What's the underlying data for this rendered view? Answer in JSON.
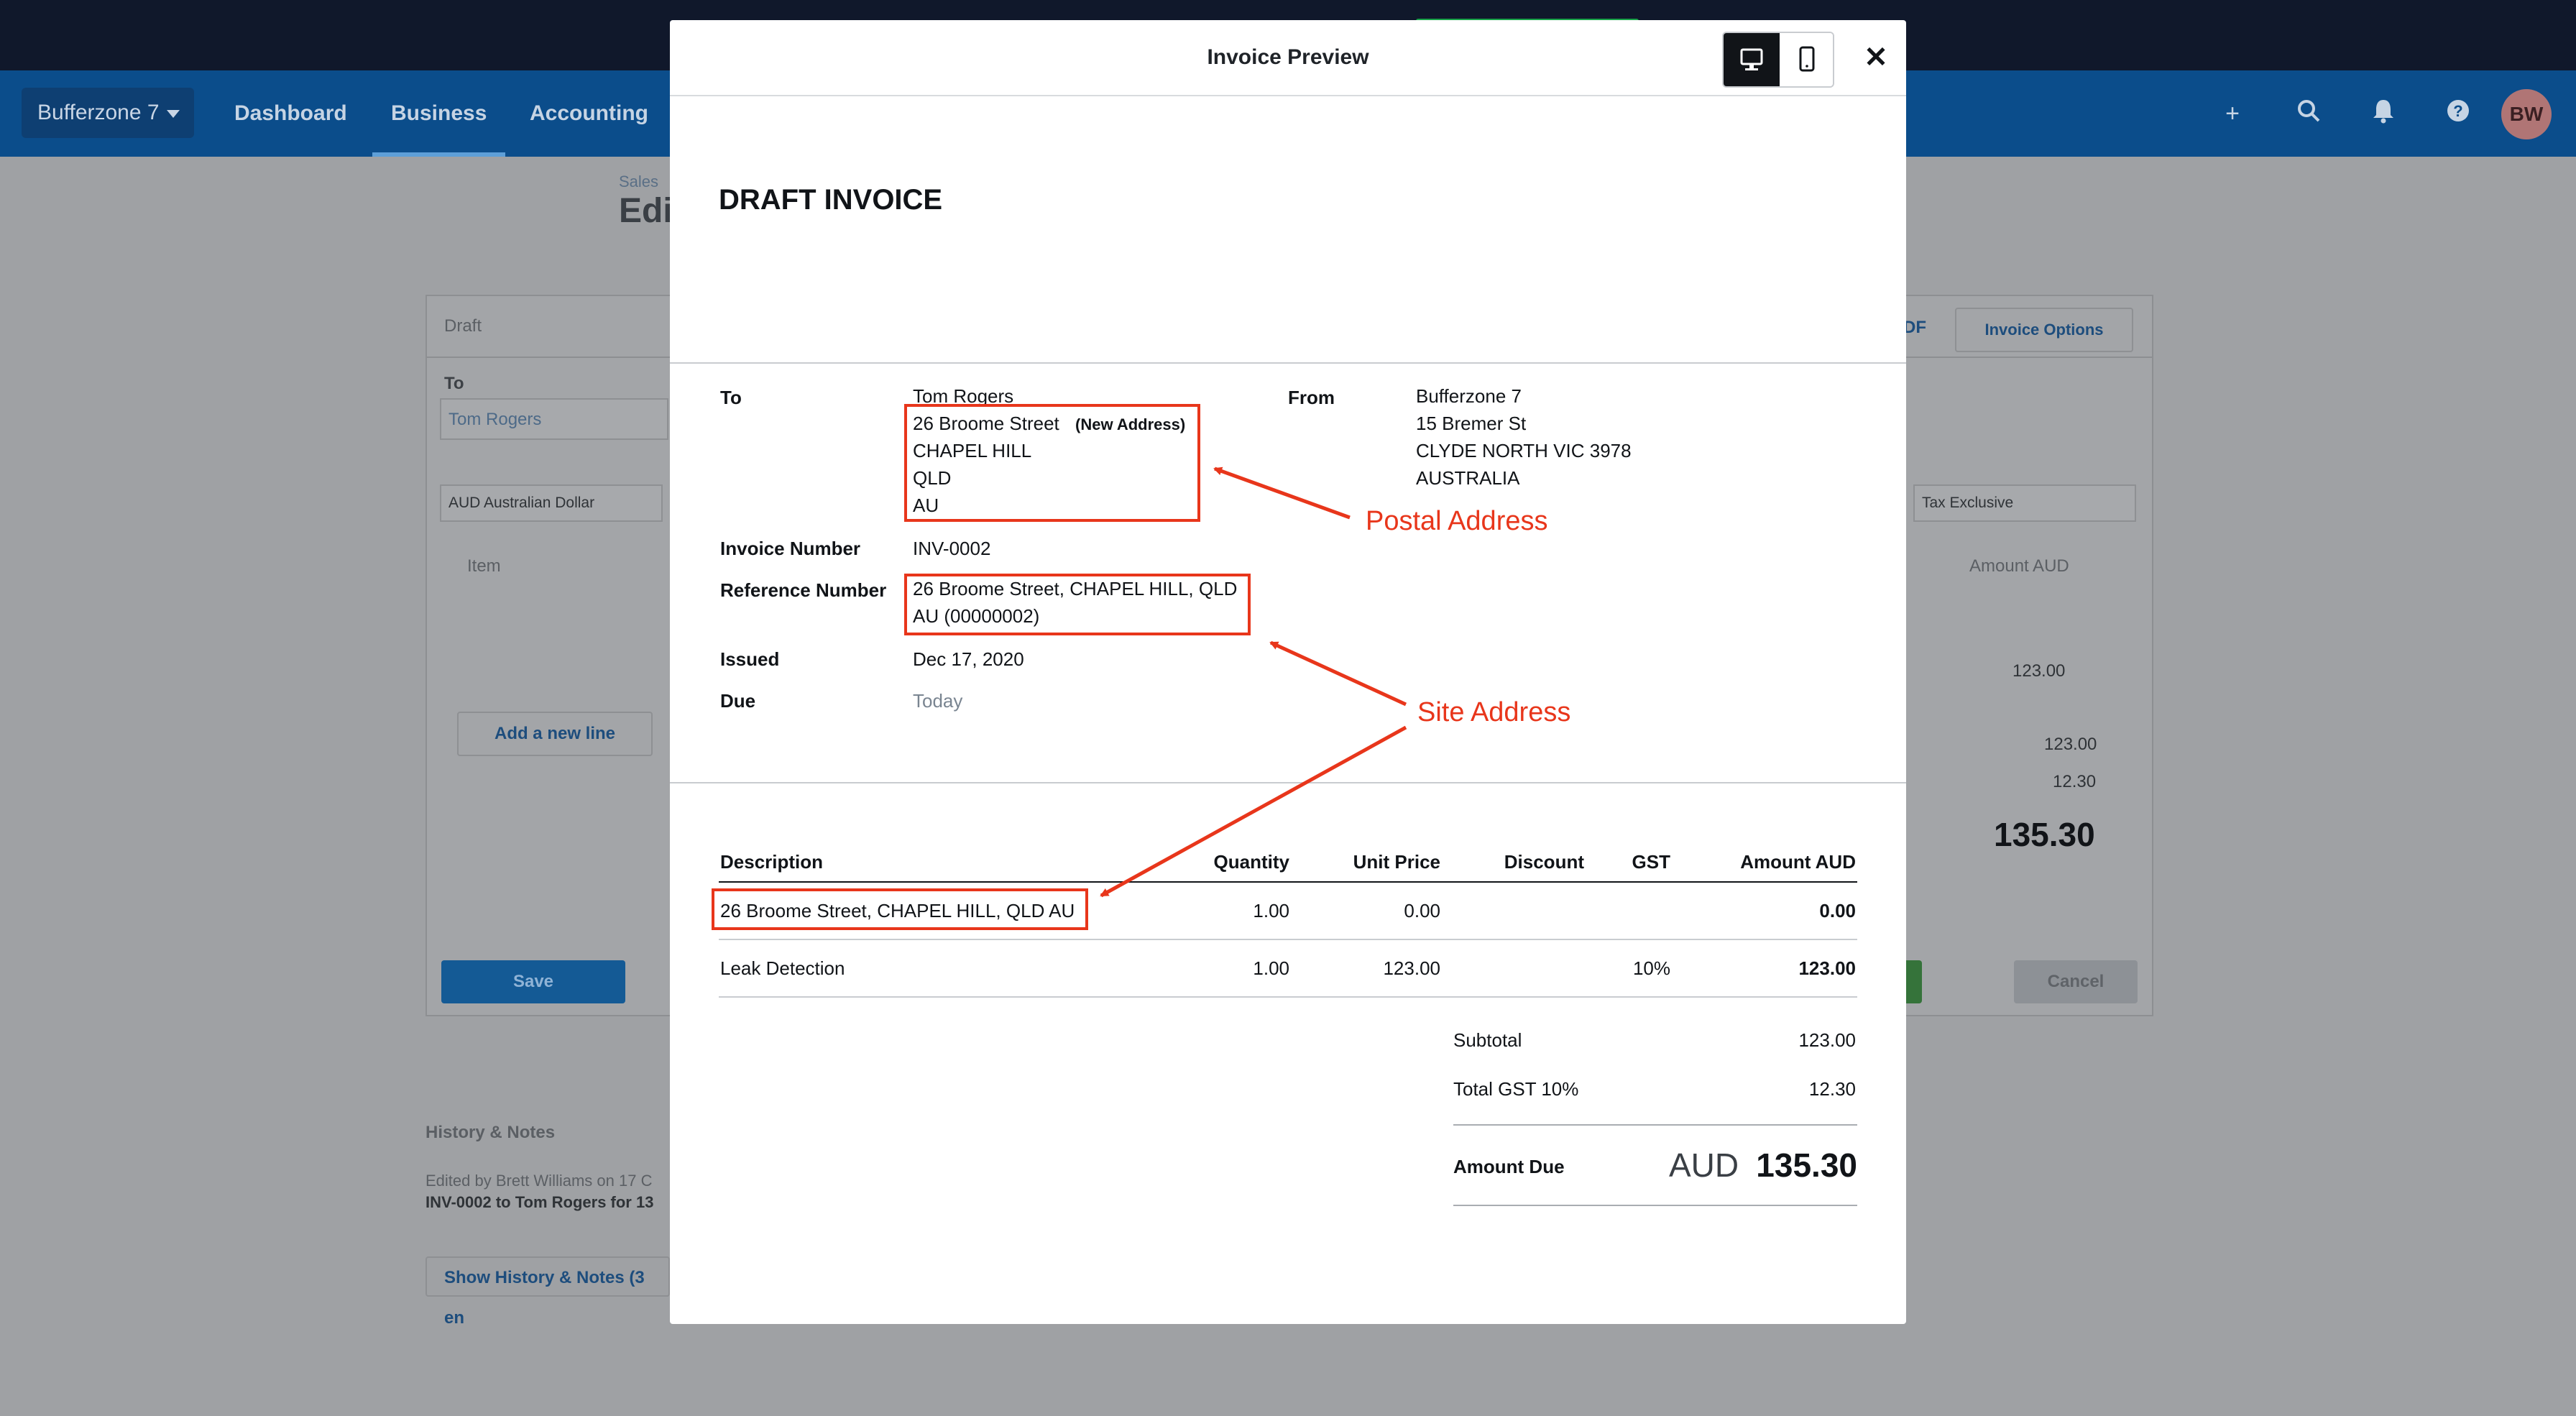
{
  "nav": {
    "org_name": "Bufferzone 7",
    "links": [
      "Dashboard",
      "Business",
      "Accounting"
    ],
    "active": "Business",
    "avatar_initials": "BW",
    "icons": [
      "plus-icon",
      "search-icon",
      "bell-icon",
      "help-icon"
    ]
  },
  "background": {
    "breadcrumb": "Sales",
    "title": "Edi",
    "status": "Draft",
    "to_label": "To",
    "to_value": "Tom Rogers",
    "currency": "AUD Australian Dollar",
    "tax_mode": "Tax Exclusive",
    "col_item": "Item",
    "col_amount": "Amount AUD",
    "row2_amount": "123.00",
    "add_line": "Add a new line",
    "sub1": "123.00",
    "sub2": "12.30",
    "total": "135.30",
    "invoice_options": "Invoice Options",
    "pdf": "DF",
    "save": "Save",
    "cancel": "Cancel",
    "history_title": "History & Notes",
    "history_line1": "Edited by Brett Williams on 17 C",
    "history_line2": "INV-0002 to Tom Rogers for 13",
    "show_history": "Show History & Notes (3 en"
  },
  "modal": {
    "title": "Invoice Preview",
    "heading": "DRAFT INVOICE",
    "to_label": "To",
    "to_lines": [
      "Tom Rogers",
      "26 Broome Street",
      "CHAPEL HILL",
      "QLD",
      "AU"
    ],
    "new_address_tag": "(New Address)",
    "from_label": "From",
    "from_lines": [
      "Bufferzone 7",
      "15 Bremer St",
      "CLYDE NORTH VIC 3978",
      "AUSTRALIA"
    ],
    "invoice_number_label": "Invoice Number",
    "invoice_number": "INV-0002",
    "reference_label": "Reference Number",
    "reference_lines": [
      "26 Broome Street, CHAPEL HILL, QLD",
      "AU (00000002)"
    ],
    "issued_label": "Issued",
    "issued": "Dec 17, 2020",
    "due_label": "Due",
    "due": "Today",
    "table": {
      "headers": [
        "Description",
        "Quantity",
        "Unit Price",
        "Discount",
        "GST",
        "Amount AUD"
      ],
      "rows": [
        {
          "description": "26 Broome Street, CHAPEL HILL, QLD AU",
          "quantity": "1.00",
          "unit_price": "0.00",
          "discount": "",
          "gst": "",
          "amount": "0.00"
        },
        {
          "description": "Leak Detection",
          "quantity": "1.00",
          "unit_price": "123.00",
          "discount": "",
          "gst": "10%",
          "amount": "123.00"
        }
      ]
    },
    "subtotal_label": "Subtotal",
    "subtotal": "123.00",
    "gst_label": "Total GST 10%",
    "gst_total": "12.30",
    "amount_due_label": "Amount Due",
    "amount_due_currency": "AUD",
    "amount_due_value": "135.30"
  },
  "annotations": {
    "postal": "Postal Address",
    "site": "Site Address",
    "color": "#e8361b"
  }
}
